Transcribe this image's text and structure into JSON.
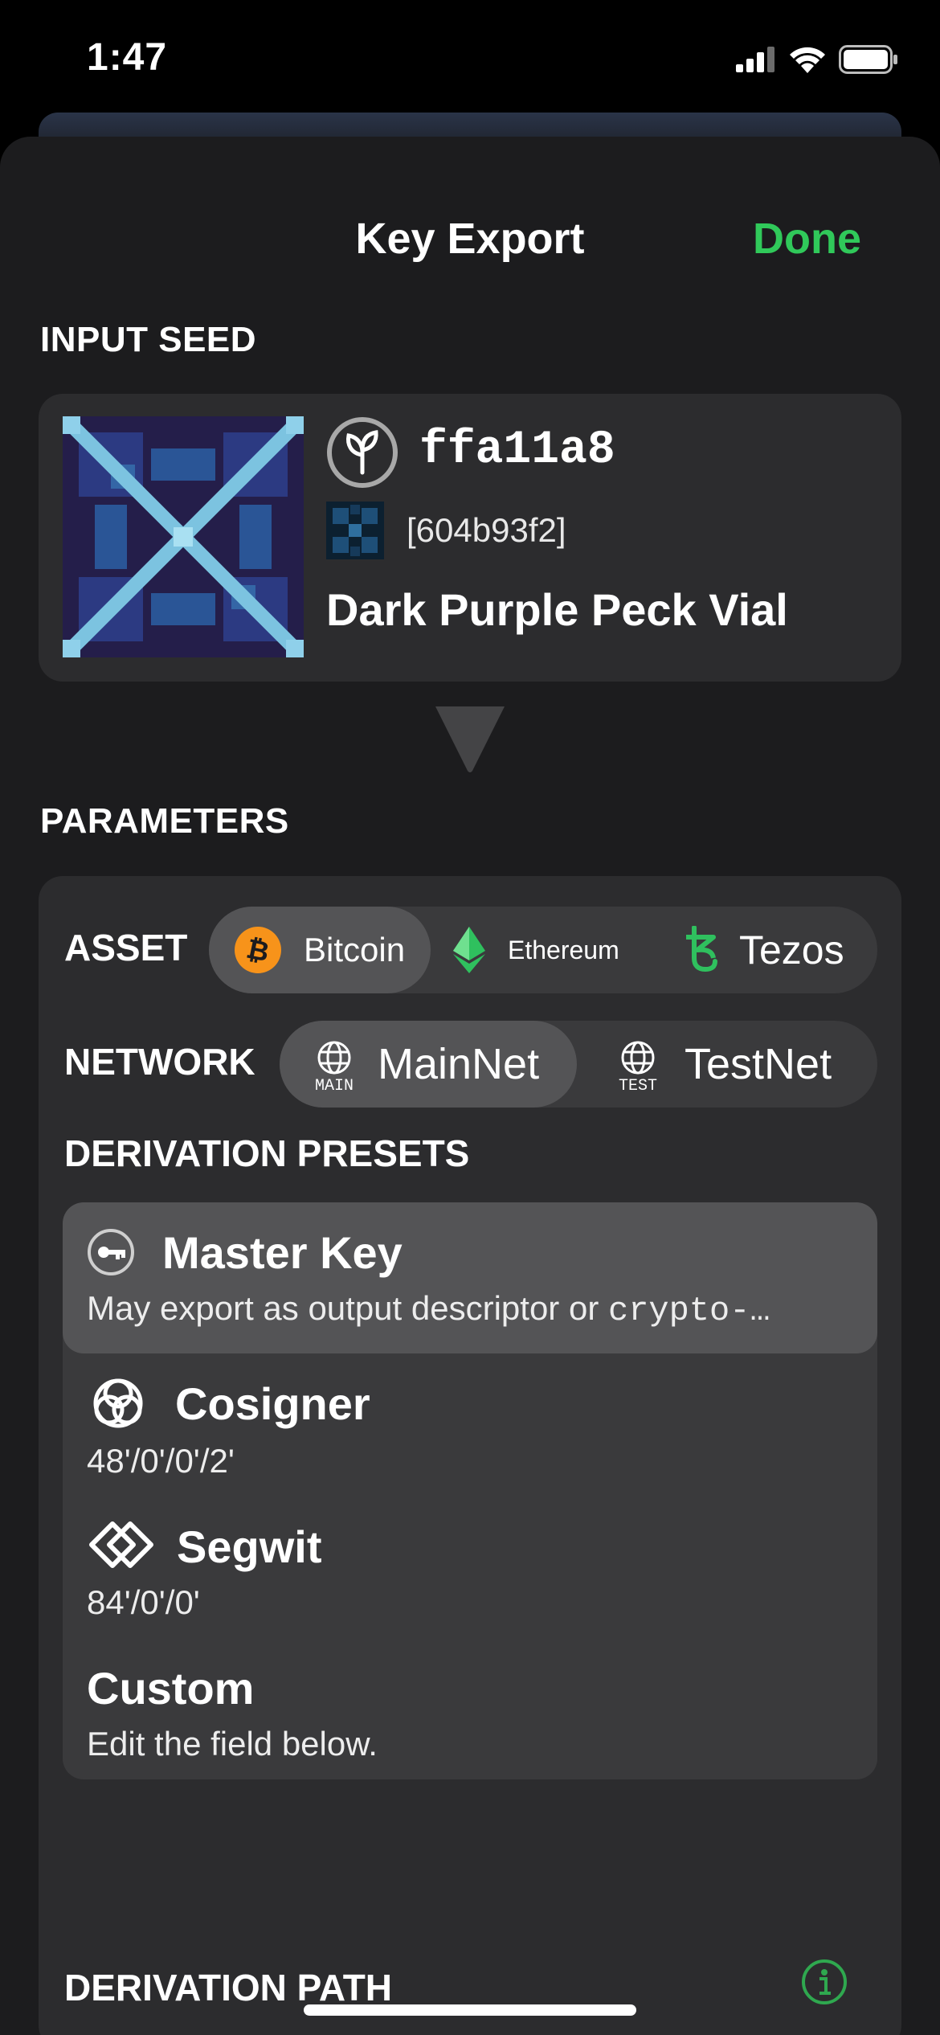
{
  "status": {
    "time": "1:47"
  },
  "nav": {
    "title": "Key Export",
    "done_label": "Done"
  },
  "input_seed": {
    "header": "INPUT SEED",
    "id": "ffa11a8",
    "fingerprint": "[604b93f2]",
    "name": "Dark Purple Peck Vial"
  },
  "parameters": {
    "header": "PARAMETERS",
    "asset": {
      "label": "ASSET",
      "options": [
        {
          "label": "Bitcoin",
          "icon": "bitcoin-icon",
          "selected": true
        },
        {
          "label": "Ethereum",
          "icon": "ethereum-icon",
          "selected": false
        },
        {
          "label": "Tezos",
          "icon": "tezos-icon",
          "selected": false
        }
      ]
    },
    "network": {
      "label": "NETWORK",
      "options": [
        {
          "label": "MainNet",
          "badge": "MAIN",
          "icon": "globe-icon",
          "selected": true
        },
        {
          "label": "TestNet",
          "badge": "TEST",
          "icon": "globe-icon",
          "selected": false
        }
      ]
    },
    "derivation_presets": {
      "header": "DERIVATION PRESETS",
      "items": [
        {
          "title": "Master Key",
          "subtitle_prefix": "May export as output descriptor or ",
          "subtitle_mono": "crypto-…",
          "icon": "key-icon",
          "selected": true
        },
        {
          "title": "Cosigner",
          "subtitle": "48'/0'/0'/2'",
          "icon": "cosigner-icon",
          "selected": false
        },
        {
          "title": "Segwit",
          "subtitle": "84'/0'/0'",
          "icon": "segwit-icon",
          "selected": false
        },
        {
          "title": "Custom",
          "subtitle": "Edit the field below.",
          "selected": false
        }
      ]
    },
    "derivation_path": {
      "header": "DERIVATION PATH"
    }
  },
  "colors": {
    "accent": "#30c95a",
    "bitcoin": "#f7931a",
    "sheet_bg": "#1c1c1e",
    "card_bg": "#2c2c2e"
  }
}
